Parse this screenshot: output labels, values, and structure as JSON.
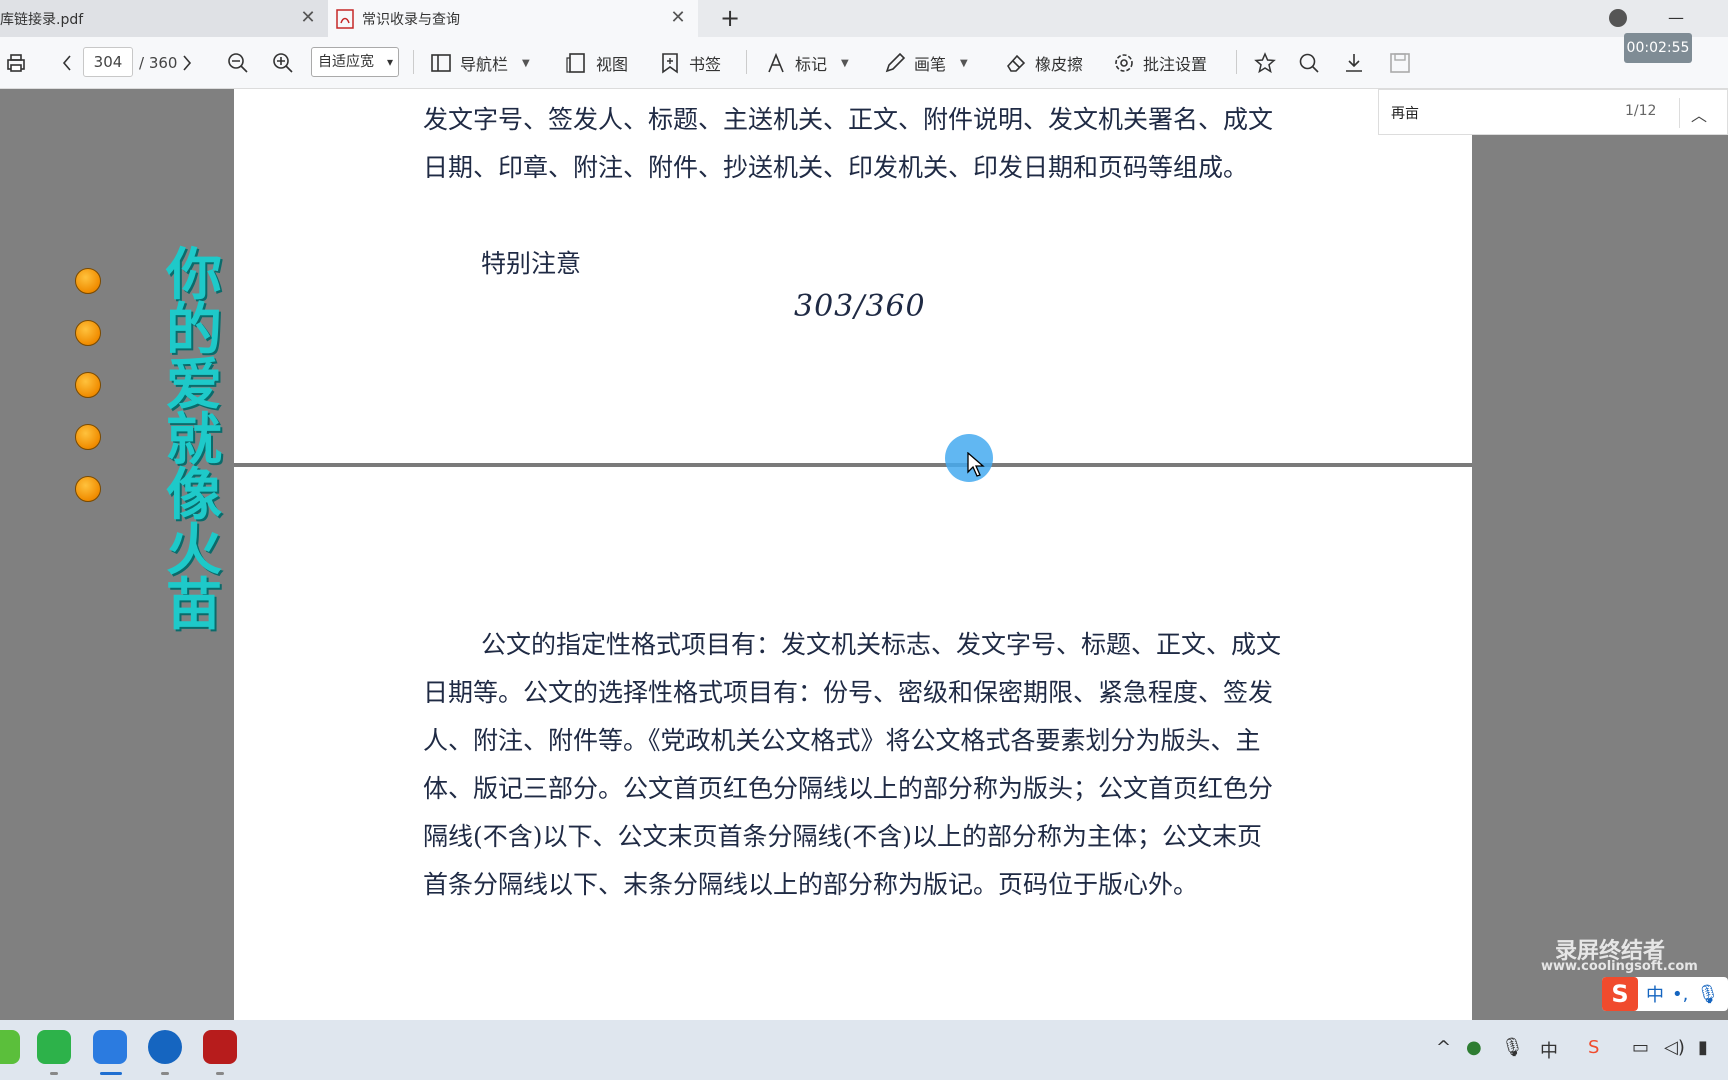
{
  "tabs": [
    {
      "label": "库链接录.pdf"
    },
    {
      "label": "常识收录与查询"
    }
  ],
  "toolbar": {
    "page_current": "304",
    "page_total": "/ 360",
    "zoom_value": "自适应宽",
    "nav_label": "导航栏",
    "view_label": "视图",
    "bookmark_label": "书签",
    "mark_label": "标记",
    "pen_label": "画笔",
    "eraser_label": "橡皮擦",
    "annot_settings_label": "批注设置"
  },
  "recorder": {
    "timer": "00:02:55"
  },
  "search": {
    "query": "再亩",
    "count": "1/12"
  },
  "decoration": {
    "text": "你的爱就像火苗"
  },
  "page_top": {
    "paragraph": "发文字号、签发人、标题、主送机关、正文、附件说明、发文机关署名、成文日期、印章、附注、附件、抄送机关、印发机关、印发日期和页码等组成。",
    "note_heading": "特别注意",
    "page_number": "303/360"
  },
  "page_bottom": {
    "paragraph": "公文的指定性格式项目有：发文机关标志、发文字号、标题、正文、成文日期等。公文的选择性格式项目有：份号、密级和保密期限、紧急程度、签发人、附注、附件等。《党政机关公文格式》将公文格式各要素划分为版头、主体、版记三部分。公文首页红色分隔线以上的部分称为版头；公文首页红色分隔线(不含)以下、公文末页首条分隔线(不含)以上的部分称为主体；公文末页首条分隔线以下、末条分隔线以上的部分称为版记。页码位于版心外。"
  },
  "watermark": {
    "title": "录屏终结者",
    "url": "www.coolingsoft.com"
  },
  "ime": {
    "logo": "S",
    "lang": "中",
    "punct": "•,"
  },
  "colors": {
    "text": "#1f2a44",
    "decoration": "#1ec9c9",
    "dot": "#f08c00"
  }
}
